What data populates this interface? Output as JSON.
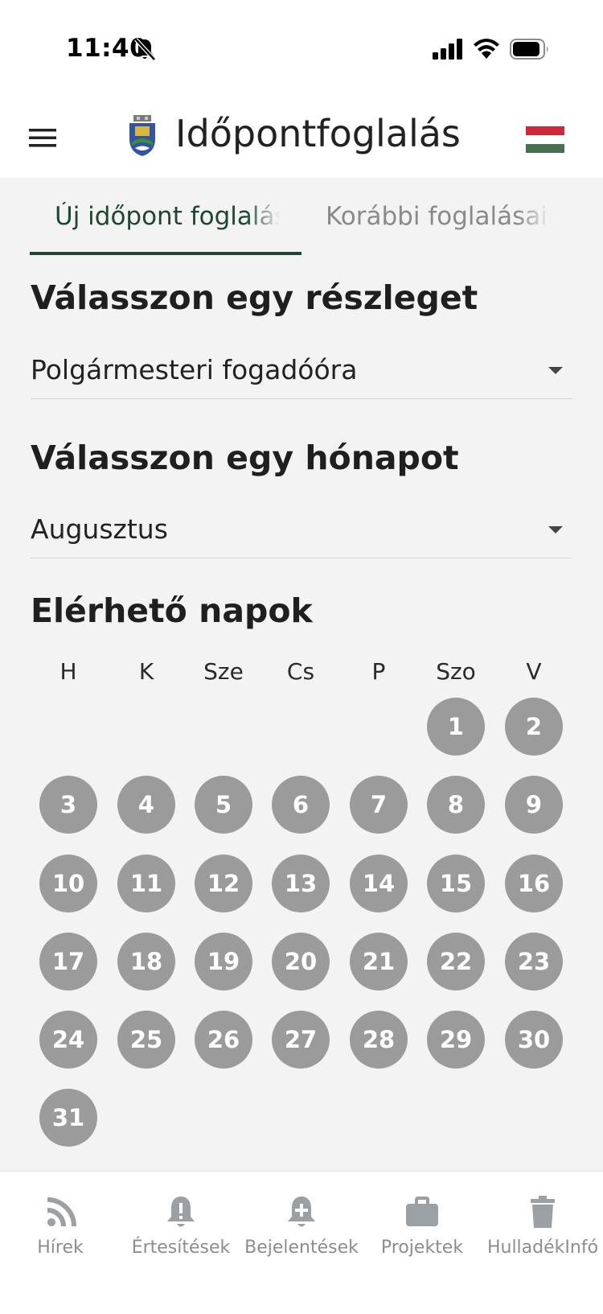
{
  "status_bar": {
    "time": "11:40"
  },
  "header": {
    "title": "Időpontfoglalás"
  },
  "tabs": [
    {
      "label": "Új időpont foglalás",
      "active": true
    },
    {
      "label": "Korábbi foglalásaim",
      "active": false
    }
  ],
  "department": {
    "heading": "Válasszon egy részleget",
    "value": "Polgármesteri fogadóóra"
  },
  "month": {
    "heading": "Válasszon egy hónapot",
    "value": "Augusztus"
  },
  "calendar": {
    "heading": "Elérhető napok",
    "weekdays": [
      "H",
      "K",
      "Sze",
      "Cs",
      "P",
      "Szo",
      "V"
    ],
    "days": [
      "1",
      "2",
      "3",
      "4",
      "5",
      "6",
      "7",
      "8",
      "9",
      "10",
      "11",
      "12",
      "13",
      "14",
      "15",
      "16",
      "17",
      "18",
      "19",
      "20",
      "21",
      "22",
      "23",
      "24",
      "25",
      "26",
      "27",
      "28",
      "29",
      "30",
      "31"
    ]
  },
  "bottom_nav": [
    {
      "label": "Hírek",
      "icon": "rss-icon"
    },
    {
      "label": "Értesítések",
      "icon": "bell-alert-icon"
    },
    {
      "label": "Bejelentések",
      "icon": "bell-plus-icon"
    },
    {
      "label": "Projektek",
      "icon": "briefcase-icon"
    },
    {
      "label": "HulladékInfó",
      "icon": "trash-icon"
    }
  ],
  "colors": {
    "accent": "#1e4630",
    "day_circle": "#9b9b9b",
    "background": "#f2f3f2",
    "nav_icon": "#9aa0a4"
  }
}
